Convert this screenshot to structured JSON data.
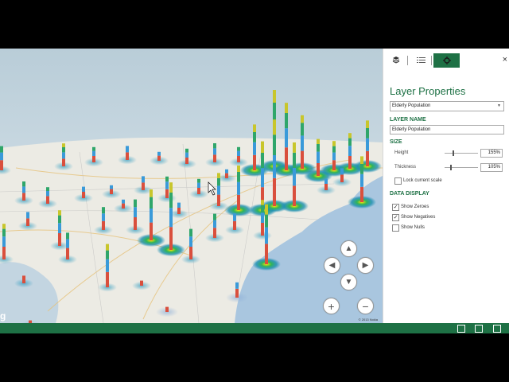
{
  "panel": {
    "tabs": [
      {
        "icon": "layers-icon"
      },
      {
        "icon": "field-list-icon"
      },
      {
        "icon": "settings-gear-icon",
        "active": true
      }
    ],
    "close_label": "×",
    "title": "Layer Properties",
    "layer_dropdown_value": "Elderly Population",
    "layer_name_heading": "LAYER NAME",
    "layer_name_value": "Elderly Population",
    "size_heading": "SIZE",
    "height_label": "Height",
    "height_value": "155%",
    "thickness_label": "Thickness",
    "thickness_value": "105%",
    "lock_scale_label": "Lock current scale",
    "lock_scale_checked": false,
    "data_display_heading": "DATA DISPLAY",
    "options": [
      {
        "label": "Show Zeroes",
        "checked": true
      },
      {
        "label": "Show Negatives",
        "checked": true
      },
      {
        "label": "Show Nulls",
        "checked": false
      }
    ]
  },
  "map": {
    "copyright": "© 2013 Nokia",
    "bing_logo": "g",
    "nav": {
      "up": "▲",
      "left": "◀",
      "right": "▶",
      "down": "▼",
      "zoom_in": "+",
      "zoom_out": "−"
    }
  },
  "colors": {
    "accent": "#1e7145",
    "statusbar": "#1e7145"
  },
  "statusbar": {
    "icons": [
      "screen-icon",
      "fit-icon",
      "fullscreen-icon"
    ]
  }
}
